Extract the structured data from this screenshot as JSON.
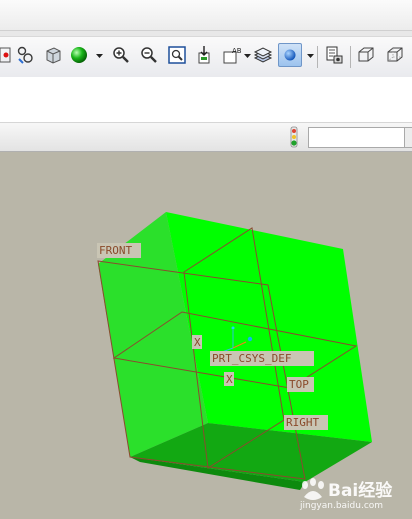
{
  "toolbar": {
    "buttons": [
      {
        "name": "regenerate-button"
      },
      {
        "name": "search-tool-button"
      },
      {
        "name": "view-orient-button"
      },
      {
        "name": "display-style-button"
      },
      {
        "name": "zoom-in-button"
      },
      {
        "name": "zoom-out-button"
      },
      {
        "name": "refit-button"
      },
      {
        "name": "reorient-button"
      },
      {
        "name": "saved-views-button"
      },
      {
        "name": "layers-button"
      },
      {
        "name": "spin-center-button"
      },
      {
        "name": "model-tree-button"
      },
      {
        "name": "shading-button"
      },
      {
        "name": "hidden-line-button"
      }
    ],
    "text_icon_label": "AB",
    "active_button": "spin-center-button"
  },
  "status": {
    "filter_value": ""
  },
  "viewport": {
    "background": "#b9b6a8",
    "model_color": "#00ff00",
    "datum_color": "#8a4a2a",
    "labels": {
      "front": "FRONT",
      "csys": "PRT_CSYS_DEF",
      "top": "TOP",
      "right": "RIGHT",
      "x_axis_1": "X",
      "x_axis_2": "X"
    }
  },
  "watermark": {
    "brand": "Bai经验",
    "url": "jingyan.baidu.com"
  }
}
